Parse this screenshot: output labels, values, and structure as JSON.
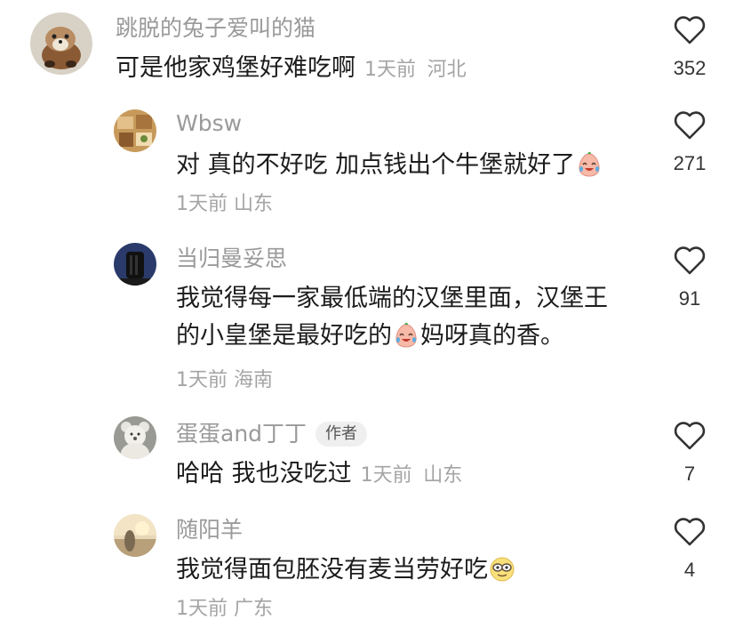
{
  "comments": [
    {
      "username": "跳脱的兔子爱叫的猫",
      "text": "可是他家鸡堡好难吃啊",
      "time": "1天前",
      "location": "河北",
      "likes": "352",
      "avatar_icon": "marten-photo-avatar"
    },
    {
      "username": "Wbsw",
      "text": "对 真的不好吃 加点钱出个牛堡就好了",
      "emoji": "crying-laughing-face",
      "time": "1天前",
      "location": "山东",
      "likes": "271",
      "avatar_icon": "food-photo-avatar"
    },
    {
      "username": "当归曼妥思",
      "text_line1": "我觉得每一家最低端的汉堡里面，汉堡王",
      "text_line2_a": "的小皇堡是最好吃的",
      "text_line2_b": "妈呀真的香。",
      "emoji": "crying-laughing-face",
      "time": "1天前",
      "location": "海南",
      "likes": "91",
      "avatar_icon": "dark-photo-avatar"
    },
    {
      "username": "蛋蛋and丁丁",
      "badge": "作者",
      "text": "哈哈 我也没吃过",
      "time": "1天前",
      "location": "山东",
      "likes": "7",
      "avatar_icon": "teddy-bear-avatar"
    },
    {
      "username": "随阳羊",
      "text": "我觉得面包胚没有麦当劳好吃",
      "emoji": "sunglasses-face",
      "time": "1天前",
      "location": "广东",
      "likes": "4",
      "avatar_icon": "sunset-photo-avatar"
    }
  ],
  "colors": {
    "username": "#9a9a9a",
    "meta": "#a4a4a4",
    "text": "#1c1c1c",
    "heart_stroke": "#333333"
  }
}
